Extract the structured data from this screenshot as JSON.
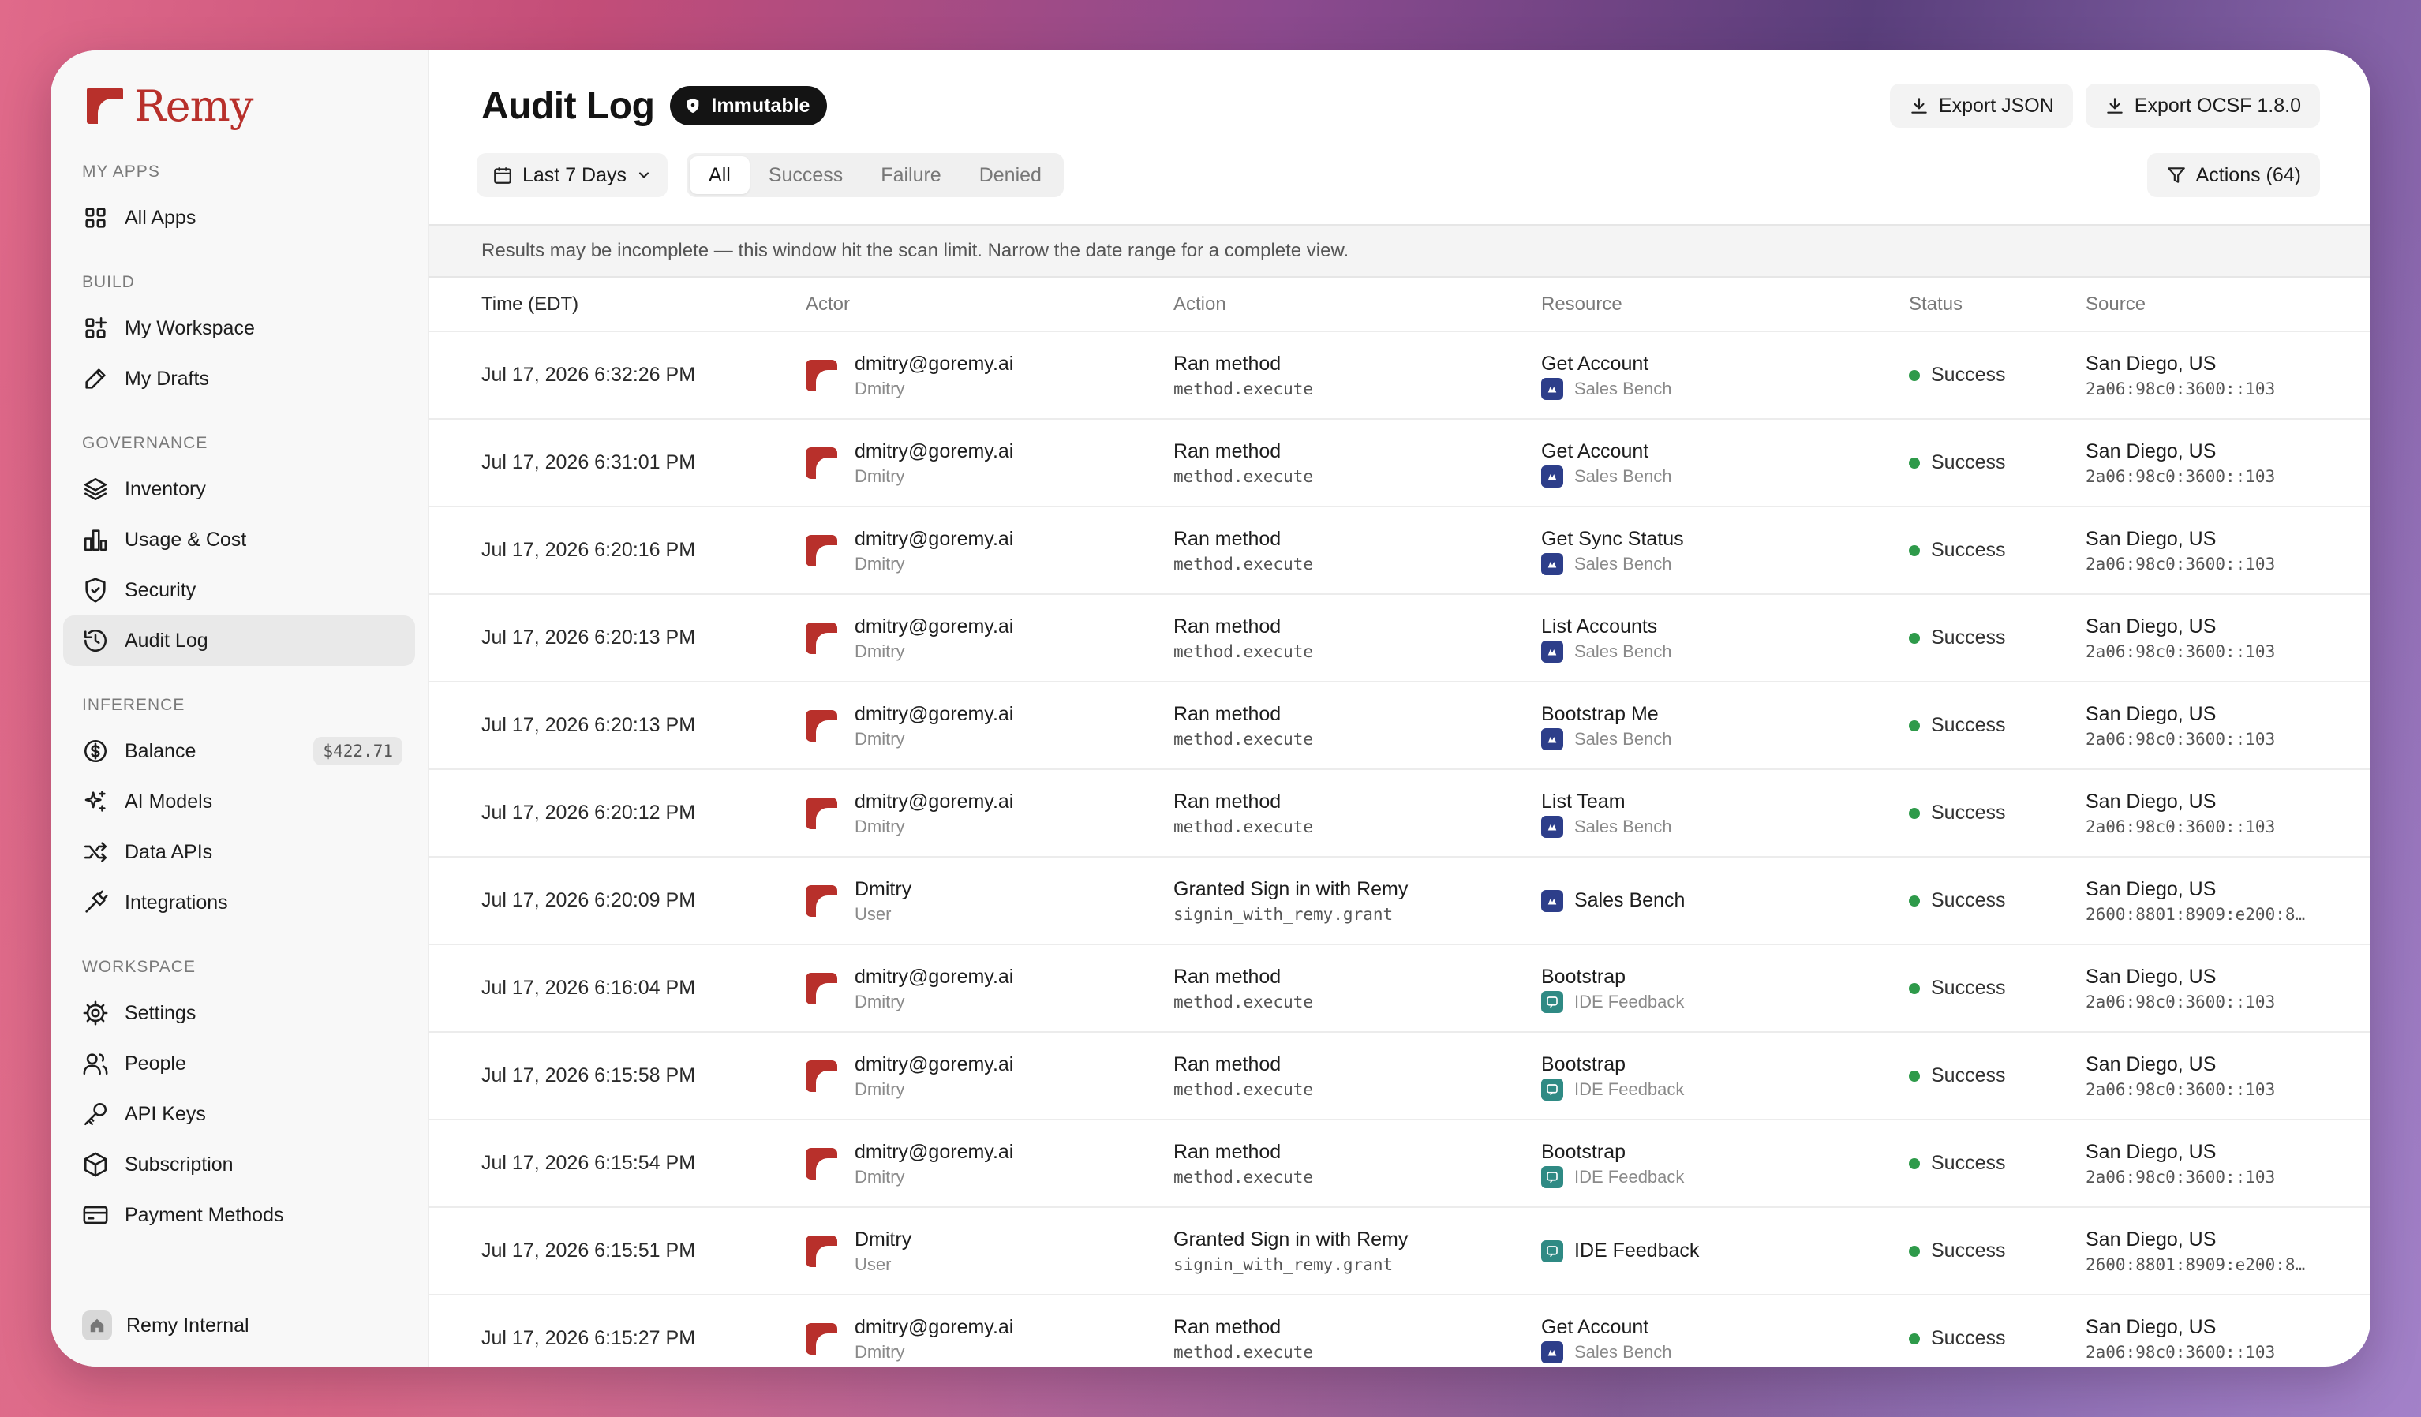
{
  "app": {
    "name": "Remy"
  },
  "sidebar": {
    "sections": [
      {
        "label": "MY APPS",
        "items": [
          {
            "label": "All Apps",
            "icon": "grid-icon"
          }
        ]
      },
      {
        "label": "BUILD",
        "items": [
          {
            "label": "My Workspace",
            "icon": "workspace-icon"
          },
          {
            "label": "My Drafts",
            "icon": "edit-icon"
          }
        ]
      },
      {
        "label": "GOVERNANCE",
        "items": [
          {
            "label": "Inventory",
            "icon": "layers-icon"
          },
          {
            "label": "Usage & Cost",
            "icon": "bar-chart-icon"
          },
          {
            "label": "Security",
            "icon": "shield-icon"
          },
          {
            "label": "Audit Log",
            "icon": "history-icon",
            "active": true
          }
        ]
      },
      {
        "label": "INFERENCE",
        "items": [
          {
            "label": "Balance",
            "icon": "dollar-icon",
            "badge": "$422.71"
          },
          {
            "label": "AI Models",
            "icon": "sparkles-icon"
          },
          {
            "label": "Data APIs",
            "icon": "shuffle-icon"
          },
          {
            "label": "Integrations",
            "icon": "plug-icon"
          }
        ]
      },
      {
        "label": "WORKSPACE",
        "items": [
          {
            "label": "Settings",
            "icon": "gear-icon"
          },
          {
            "label": "People",
            "icon": "people-icon"
          },
          {
            "label": "API Keys",
            "icon": "key-icon"
          },
          {
            "label": "Subscription",
            "icon": "box-icon"
          },
          {
            "label": "Payment Methods",
            "icon": "credit-card-icon"
          }
        ]
      }
    ],
    "workspace": "Remy Internal"
  },
  "header": {
    "title": "Audit Log",
    "badge": "Immutable",
    "export_json": "Export JSON",
    "export_ocsf": "Export OCSF 1.8.0"
  },
  "toolbar": {
    "date_range": "Last 7 Days",
    "filters": [
      "All",
      "Success",
      "Failure",
      "Denied"
    ],
    "active_filter": "All",
    "actions": "Actions (64)"
  },
  "notice": "Results may be incomplete — this window hit the scan limit. Narrow the date range for a complete view.",
  "table": {
    "columns": [
      "Time (EDT)",
      "Actor",
      "Action",
      "Resource",
      "Status",
      "Source"
    ],
    "rows": [
      {
        "time": "Jul 17, 2026 6:32:26 PM",
        "actor": "dmitry@goremy.ai",
        "actor_sub": "Dmitry",
        "action": "Ran method",
        "action_sub": "method.execute",
        "resource": "Get Account",
        "resource_app": "Sales Bench",
        "app_kind": "sb",
        "status": "Success",
        "source": "San Diego, US",
        "source_ip": "2a06:98c0:3600::103"
      },
      {
        "time": "Jul 17, 2026 6:31:01 PM",
        "actor": "dmitry@goremy.ai",
        "actor_sub": "Dmitry",
        "action": "Ran method",
        "action_sub": "method.execute",
        "resource": "Get Account",
        "resource_app": "Sales Bench",
        "app_kind": "sb",
        "status": "Success",
        "source": "San Diego, US",
        "source_ip": "2a06:98c0:3600::103"
      },
      {
        "time": "Jul 17, 2026 6:20:16 PM",
        "actor": "dmitry@goremy.ai",
        "actor_sub": "Dmitry",
        "action": "Ran method",
        "action_sub": "method.execute",
        "resource": "Get Sync Status",
        "resource_app": "Sales Bench",
        "app_kind": "sb",
        "status": "Success",
        "source": "San Diego, US",
        "source_ip": "2a06:98c0:3600::103"
      },
      {
        "time": "Jul 17, 2026 6:20:13 PM",
        "actor": "dmitry@goremy.ai",
        "actor_sub": "Dmitry",
        "action": "Ran method",
        "action_sub": "method.execute",
        "resource": "List Accounts",
        "resource_app": "Sales Bench",
        "app_kind": "sb",
        "status": "Success",
        "source": "San Diego, US",
        "source_ip": "2a06:98c0:3600::103"
      },
      {
        "time": "Jul 17, 2026 6:20:13 PM",
        "actor": "dmitry@goremy.ai",
        "actor_sub": "Dmitry",
        "action": "Ran method",
        "action_sub": "method.execute",
        "resource": "Bootstrap Me",
        "resource_app": "Sales Bench",
        "app_kind": "sb",
        "status": "Success",
        "source": "San Diego, US",
        "source_ip": "2a06:98c0:3600::103"
      },
      {
        "time": "Jul 17, 2026 6:20:12 PM",
        "actor": "dmitry@goremy.ai",
        "actor_sub": "Dmitry",
        "action": "Ran method",
        "action_sub": "method.execute",
        "resource": "List Team",
        "resource_app": "Sales Bench",
        "app_kind": "sb",
        "status": "Success",
        "source": "San Diego, US",
        "source_ip": "2a06:98c0:3600::103"
      },
      {
        "time": "Jul 17, 2026 6:20:09 PM",
        "actor": "Dmitry",
        "actor_sub": "User",
        "action": "Granted Sign in with Remy",
        "action_sub": "signin_with_remy.grant",
        "resource": "",
        "resource_app": "Sales Bench",
        "app_kind": "sb",
        "single": true,
        "status": "Success",
        "source": "San Diego, US",
        "source_ip": "2600:8801:8909:e200:8…"
      },
      {
        "time": "Jul 17, 2026 6:16:04 PM",
        "actor": "dmitry@goremy.ai",
        "actor_sub": "Dmitry",
        "action": "Ran method",
        "action_sub": "method.execute",
        "resource": "Bootstrap",
        "resource_app": "IDE Feedback",
        "app_kind": "ide",
        "status": "Success",
        "source": "San Diego, US",
        "source_ip": "2a06:98c0:3600::103"
      },
      {
        "time": "Jul 17, 2026 6:15:58 PM",
        "actor": "dmitry@goremy.ai",
        "actor_sub": "Dmitry",
        "action": "Ran method",
        "action_sub": "method.execute",
        "resource": "Bootstrap",
        "resource_app": "IDE Feedback",
        "app_kind": "ide",
        "status": "Success",
        "source": "San Diego, US",
        "source_ip": "2a06:98c0:3600::103"
      },
      {
        "time": "Jul 17, 2026 6:15:54 PM",
        "actor": "dmitry@goremy.ai",
        "actor_sub": "Dmitry",
        "action": "Ran method",
        "action_sub": "method.execute",
        "resource": "Bootstrap",
        "resource_app": "IDE Feedback",
        "app_kind": "ide",
        "status": "Success",
        "source": "San Diego, US",
        "source_ip": "2a06:98c0:3600::103"
      },
      {
        "time": "Jul 17, 2026 6:15:51 PM",
        "actor": "Dmitry",
        "actor_sub": "User",
        "action": "Granted Sign in with Remy",
        "action_sub": "signin_with_remy.grant",
        "resource": "",
        "resource_app": "IDE Feedback",
        "app_kind": "ide",
        "single": true,
        "status": "Success",
        "source": "San Diego, US",
        "source_ip": "2600:8801:8909:e200:8…"
      },
      {
        "time": "Jul 17, 2026 6:15:27 PM",
        "actor": "dmitry@goremy.ai",
        "actor_sub": "Dmitry",
        "action": "Ran method",
        "action_sub": "method.execute",
        "resource": "Get Account",
        "resource_app": "Sales Bench",
        "app_kind": "sb",
        "status": "Success",
        "source": "San Diego, US",
        "source_ip": "2a06:98c0:3600::103"
      }
    ]
  },
  "colors": {
    "brand": "#b8302b",
    "success": "#2e9a4a",
    "sales_bench": "#2d3e8a",
    "ide_feedback": "#2f8a84"
  }
}
